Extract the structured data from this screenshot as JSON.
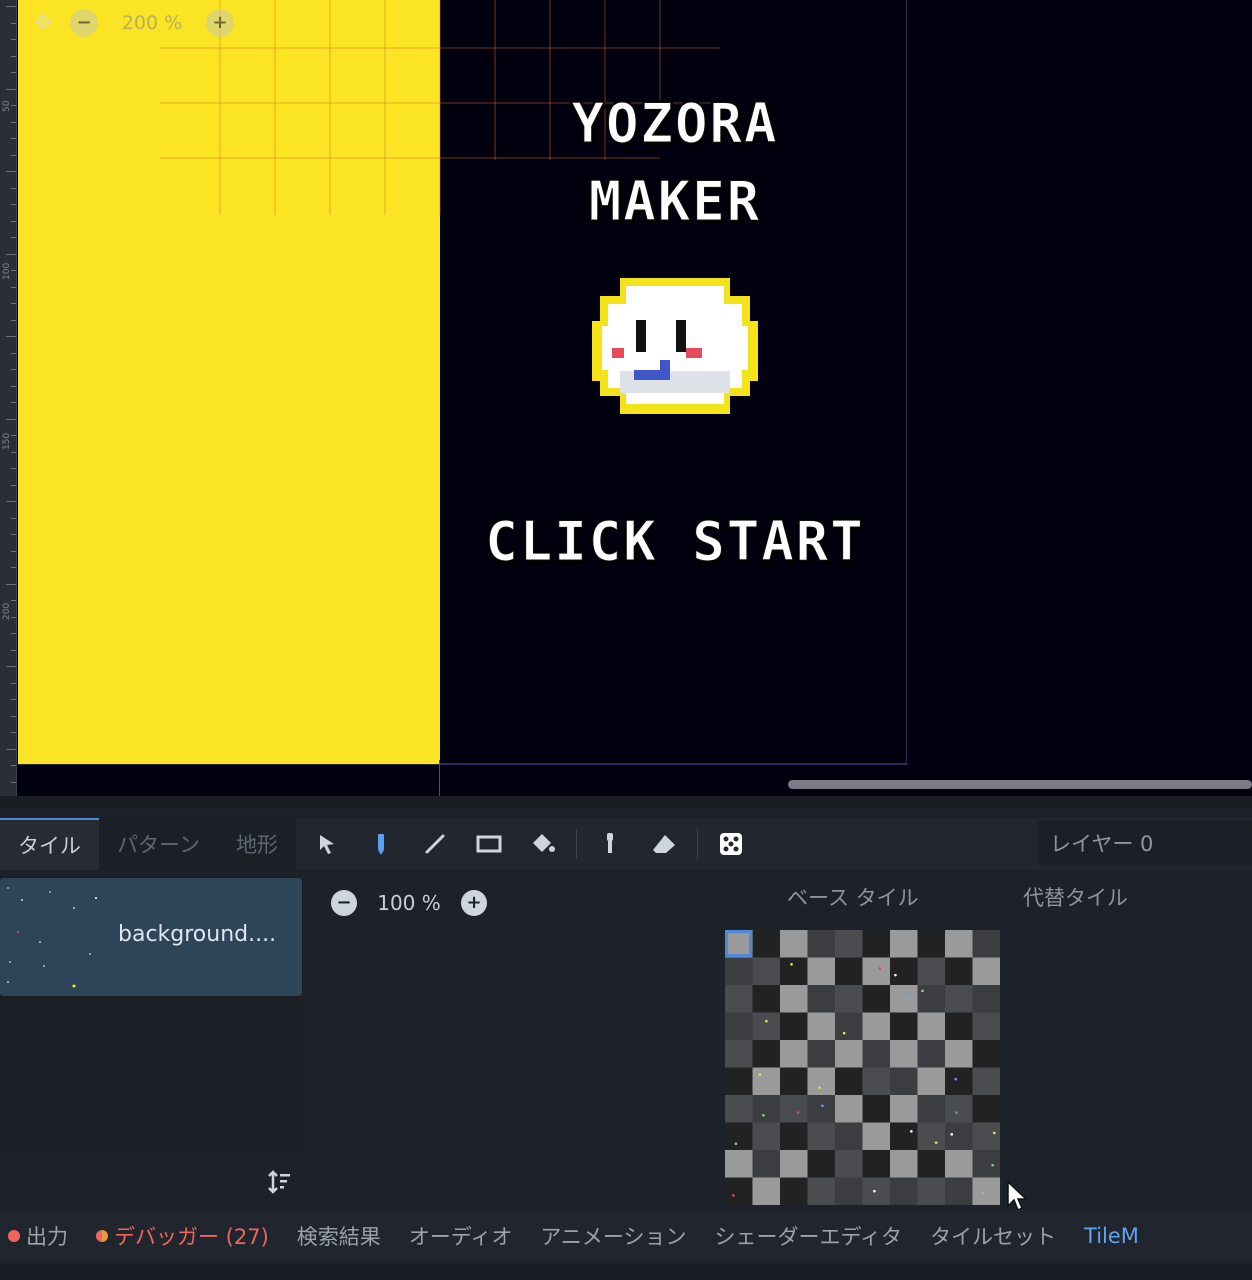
{
  "viewport": {
    "zoom_label": "200 %",
    "ruler_labels": [
      "50",
      "100",
      "150",
      "200"
    ],
    "title_line1": "YOZORA",
    "title_line2": "MAKER",
    "start_text": "CLICK START"
  },
  "tabs": [
    {
      "label": "タイル",
      "active": true
    },
    {
      "label": "パターン",
      "active": false
    },
    {
      "label": "地形",
      "active": false
    }
  ],
  "tools": [
    "select-icon",
    "paint-icon",
    "line-icon",
    "rect-icon",
    "bucket-icon",
    "picker-icon",
    "eraser-icon",
    "random-icon"
  ],
  "layer": {
    "label": "レイヤー 0"
  },
  "source": {
    "label": "background...."
  },
  "atlas": {
    "zoom_label": "100 %",
    "base_tile_label": "ベース タイル",
    "alt_tile_label": "代替タイル"
  },
  "status": {
    "output": "出力",
    "debugger": "デバッガー (27)",
    "search": "検索結果",
    "audio": "オーディオ",
    "animation": "アニメーション",
    "shader": "シェーダーエディタ",
    "tileset": "タイルセット",
    "tilemap": "TileM"
  },
  "colors": {
    "accent": "#4e88d6",
    "error": "#f0645e",
    "warning": "#e59a3d",
    "canvas_yellow": "#fbe423",
    "night": "#01000f"
  }
}
